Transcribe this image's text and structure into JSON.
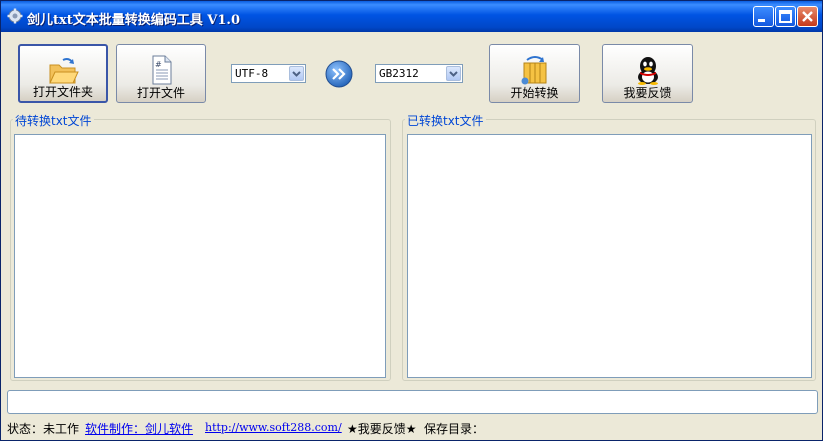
{
  "window": {
    "title": "剑儿txt文本批量转换编码工具 V1.0",
    "controls": [
      "minimize",
      "maximize",
      "close"
    ]
  },
  "toolbar": {
    "open_folder_label": "打开文件夹",
    "open_file_label": "打开文件",
    "start_convert_label": "开始转换",
    "feedback_label": "我要反馈",
    "source_encoding": "UTF-8",
    "target_encoding": "GB2312",
    "icons": {
      "open_folder": "folder-open-icon",
      "open_file": "document-icon",
      "arrow": "double-chevron-right-icon",
      "start_convert": "convert-icon",
      "feedback": "penguin-icon"
    }
  },
  "panels": {
    "pending_title": "待转换txt文件",
    "converted_title": "已转换txt文件"
  },
  "status": {
    "state_label": "状态：未工作",
    "author_link": "软件制作：剑儿软件",
    "url_link": "http://www.soft288.com/",
    "feedback_text": "★我要反馈★",
    "save_dir_label": "保存目录："
  },
  "colors": {
    "titlebar": "#0054e3",
    "window_bg": "#ece9d8",
    "group_title": "#0046d5",
    "link": "#0000ee"
  }
}
